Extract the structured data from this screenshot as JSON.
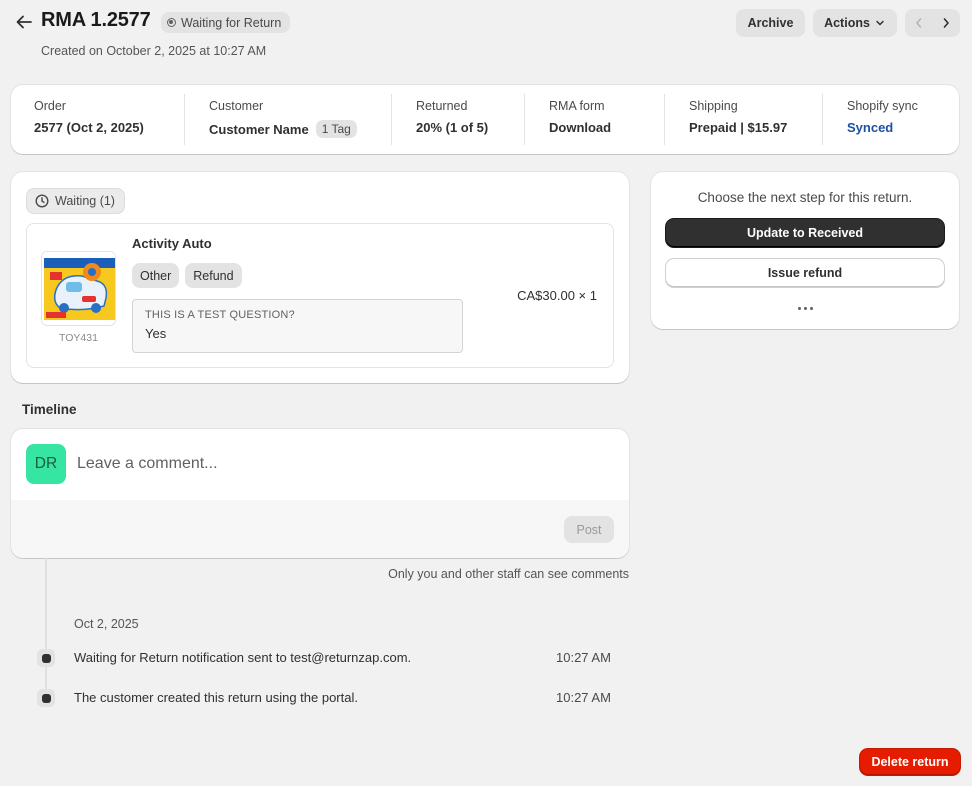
{
  "header": {
    "title": "RMA 1.2577",
    "status": "Waiting for Return",
    "created": "Created on October 2, 2025 at 10:27 AM",
    "archive_label": "Archive",
    "actions_label": "Actions"
  },
  "summary": {
    "order": {
      "label": "Order",
      "value": "2577 (Oct 2, 2025)"
    },
    "customer": {
      "label": "Customer",
      "value": "Customer Name",
      "tag": "1 Tag"
    },
    "returned": {
      "label": "Returned",
      "value": "20% (1 of 5)"
    },
    "rma_form": {
      "label": "RMA form",
      "value": "Download"
    },
    "shipping": {
      "label": "Shipping",
      "value": "Prepaid | $15.97"
    },
    "shopify_sync": {
      "label": "Shopify sync",
      "value": "Synced"
    }
  },
  "items": {
    "group_label": "Waiting (1)",
    "item": {
      "name": "Activity Auto",
      "sku": "TOY431",
      "chips": [
        "Other",
        "Refund"
      ],
      "question": "THIS IS A TEST QUESTION?",
      "answer": "Yes",
      "price": "CA$30.00 × 1"
    }
  },
  "next_step": {
    "prompt": "Choose the next step for this return.",
    "primary_label": "Update to Received",
    "secondary_label": "Issue refund"
  },
  "timeline": {
    "title": "Timeline",
    "avatar_initials": "DR",
    "comment_placeholder": "Leave a comment...",
    "post_label": "Post",
    "staff_note": "Only you and other staff can see comments",
    "date": "Oct 2, 2025",
    "events": [
      {
        "text": "Waiting for Return notification sent to test@returnzap.com.",
        "time": "10:27 AM"
      },
      {
        "text": "The customer created this return using the portal.",
        "time": "10:27 AM"
      }
    ]
  },
  "delete_label": "Delete return",
  "colors": {
    "primary": "#303030",
    "danger": "#e51c00",
    "link": "#1e4fa3",
    "avatar": "#36e5a2"
  }
}
